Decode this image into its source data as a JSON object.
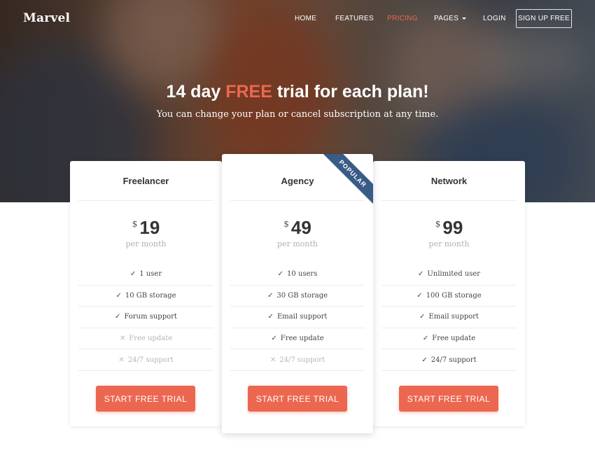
{
  "nav": {
    "logo": "Marvel",
    "items": [
      "HOME",
      "FEATURES",
      "PRICING",
      "PAGES",
      "LOGIN"
    ],
    "active": "PRICING",
    "signup_label": "SIGN UP FREE"
  },
  "hero": {
    "title_before": "14 day ",
    "title_accent": "FREE",
    "title_after": " trial for each plan!",
    "subtitle": "You can change your plan or cancel subscription at any time."
  },
  "colors": {
    "accent": "#ec6750",
    "ribbon": "#3a5b86"
  },
  "plans": [
    {
      "name": "Freelancer",
      "currency": "$",
      "price": "19",
      "period": "per month",
      "features": [
        {
          "label": "1 user",
          "included": true
        },
        {
          "label": "10 GB storage",
          "included": true
        },
        {
          "label": "Forum support",
          "included": true
        },
        {
          "label": "Free update",
          "included": false
        },
        {
          "label": "24/7 support",
          "included": false
        }
      ],
      "cta": "START FREE TRIAL"
    },
    {
      "name": "Agency",
      "badge": "POPULAR",
      "currency": "$",
      "price": "49",
      "period": "per month",
      "features": [
        {
          "label": "10 users",
          "included": true
        },
        {
          "label": "30 GB storage",
          "included": true
        },
        {
          "label": "Email support",
          "included": true
        },
        {
          "label": "Free update",
          "included": true
        },
        {
          "label": "24/7 support",
          "included": false
        }
      ],
      "cta": "START FREE TRIAL"
    },
    {
      "name": "Network",
      "currency": "$",
      "price": "99",
      "period": "per month",
      "features": [
        {
          "label": "Unlimited user",
          "included": true
        },
        {
          "label": "100 GB storage",
          "included": true
        },
        {
          "label": "Email support",
          "included": true
        },
        {
          "label": "Free update",
          "included": true
        },
        {
          "label": "24/7 support",
          "included": true
        }
      ],
      "cta": "START FREE TRIAL"
    }
  ],
  "icons": {
    "included": "check-icon",
    "excluded": "cross-icon"
  }
}
